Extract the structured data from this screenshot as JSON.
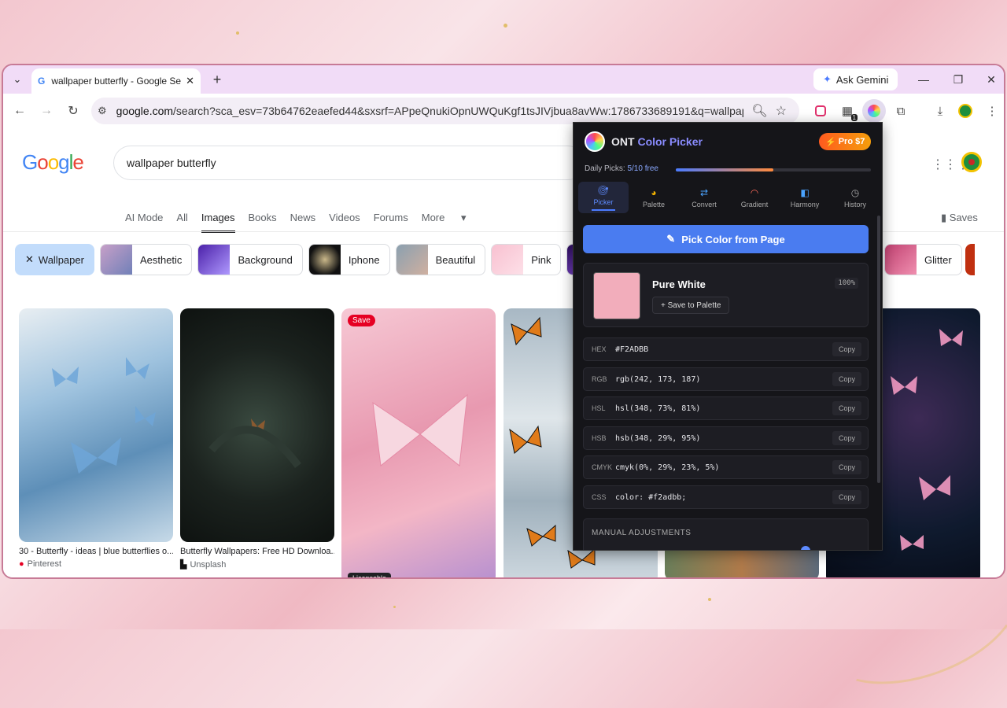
{
  "browser": {
    "tab_title": "wallpaper butterfly - Google Se",
    "gemini_label": "Ask Gemini",
    "url_host": "google.com",
    "url_rest": "/search?sca_esv=73b64762eaefed44&sxsrf=APpeQnukiOpnUWQuKgf1tsJIVjbua8avWw:1786733689191&q=wallpaper+but...",
    "ext_badge": "1"
  },
  "google": {
    "logo": "Google",
    "query": "wallpaper butterfly",
    "tabs": [
      "AI Mode",
      "All",
      "Images",
      "Books",
      "News",
      "Videos",
      "Forums",
      "More"
    ],
    "active_tab": "Images",
    "saves_label": "Saves",
    "chips": [
      {
        "label": "Wallpaper",
        "selected": true
      },
      {
        "label": "Aesthetic"
      },
      {
        "label": "Background"
      },
      {
        "label": "Iphone"
      },
      {
        "label": "Beautiful"
      },
      {
        "label": "Pink"
      },
      {
        "label": "Glitter"
      }
    ],
    "results": [
      {
        "caption": "30 - Butterfly - ideas | blue butterflies o...",
        "source": "Pinterest"
      },
      {
        "caption": "Butterfly Wallpapers: Free HD Downloa...",
        "source": "Unsplash"
      },
      {
        "save_badge": "Save",
        "licensable": "Licensable"
      }
    ]
  },
  "picker": {
    "brand_a": "ONT",
    "brand_b": "Color Picker",
    "pro_label": "Pro $7",
    "daily_label": "Daily Picks:",
    "daily_value": "5/10 free",
    "daily_fraction": 0.5,
    "tabs": [
      "Picker",
      "Palette",
      "Convert",
      "Gradient",
      "Harmony",
      "History"
    ],
    "active_tab": "Picker",
    "pick_button": "Pick Color from Page",
    "color_name": "Pure White",
    "color_hex": "#F2ADBB",
    "percent": "100%",
    "save_palette": "+ Save to Palette",
    "copy_label": "Copy",
    "formats": [
      {
        "key": "HEX",
        "value": "#F2ADBB"
      },
      {
        "key": "RGB",
        "value": "rgb(242, 173, 187)"
      },
      {
        "key": "HSL",
        "value": "hsl(348, 73%, 81%)"
      },
      {
        "key": "HSB",
        "value": "hsb(348, 29%, 95%)"
      },
      {
        "key": "CMYK",
        "value": "cmyk(0%, 29%, 23%, 5%)"
      },
      {
        "key": "CSS",
        "value": "color: #f2adbb;"
      }
    ],
    "manual_title": "MANUAL ADJUSTMENTS"
  }
}
